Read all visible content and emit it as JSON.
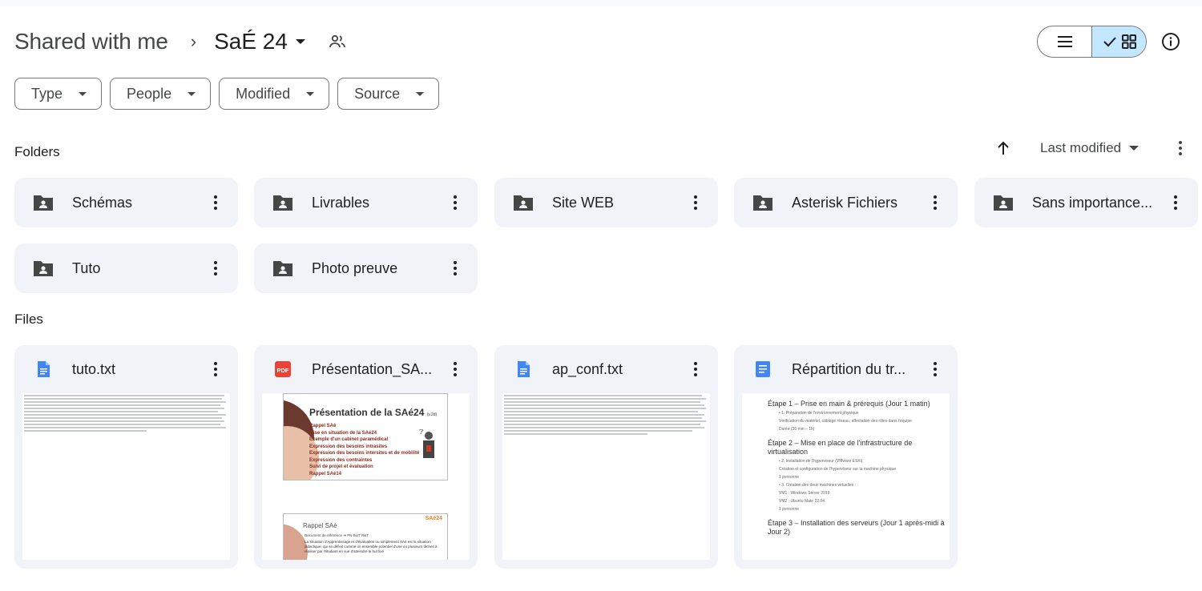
{
  "header": {
    "breadcrumb_root": "Shared with me",
    "breadcrumb_separator": "›",
    "current_folder": "SaÉ 24"
  },
  "view_toggle": {
    "list_icon": "list-view-icon",
    "grid_icon": "grid-view-icon",
    "active": "grid"
  },
  "filters": [
    {
      "label": "Type"
    },
    {
      "label": "People"
    },
    {
      "label": "Modified"
    },
    {
      "label": "Source"
    }
  ],
  "folders_section": {
    "title": "Folders",
    "sort_label": "Last modified",
    "items": [
      {
        "name": "Schémas"
      },
      {
        "name": "Livrables"
      },
      {
        "name": "Site WEB"
      },
      {
        "name": "Asterisk Fichiers"
      },
      {
        "name": "Sans importance..."
      },
      {
        "name": "Tuto"
      },
      {
        "name": "Photo preuve"
      }
    ]
  },
  "files_section": {
    "title": "Files",
    "items": [
      {
        "name": "tuto.txt",
        "type": "text",
        "icon": "google-docs-icon"
      },
      {
        "name": "Présentation_SA...",
        "type": "pdf",
        "icon": "pdf-icon"
      },
      {
        "name": "ap_conf.txt",
        "type": "text",
        "icon": "google-docs-icon"
      },
      {
        "name": "Répartition du tr...",
        "type": "doc",
        "icon": "google-docs-icon"
      }
    ]
  },
  "pdf_preview": {
    "title": "Présentation de la SAé24",
    "title_suffix": "(v.2d)",
    "bullets": [
      "Rappel SAé",
      "Mise en situation de la SAé24",
      "Exemple d'un cabinet paramédical",
      "Expression des besoins intrasites",
      "Expression des besoins intersites et de mobilité",
      "Expression des contraintes",
      "Suivi de projet et évaluation",
      "Rappel SAé14"
    ],
    "slide2_title": "Rappel SAé",
    "slide2_badge": "SAé24",
    "slide2_line1": "Document de référence ➔ PN BUT R&T",
    "slide2_line2": "La Situation d'Apprentissage et d'évaluation ou simplement SAé est la situation didactique, qui se définit comme un ensemble potentiel d'une ou plusieurs tâches à réaliser par l'étudiant en vue d'atteindre le but fixé"
  },
  "doc_preview": {
    "lines": [
      {
        "kind": "h",
        "text": "Étape 1 – Prise en main & prérequis (Jour 1 matin)"
      },
      {
        "kind": "s",
        "text": "• 1. Préparation de l'environnement physique"
      },
      {
        "kind": "s",
        "text": "Vérification du matériel, câblage réseau, affectation des rôles dans l'équipe"
      },
      {
        "kind": "s",
        "text": "Durée (30 min – 1h)"
      },
      {
        "kind": "h",
        "text": "Étape 2 – Mise en place de l'infrastructure de virtualisation"
      },
      {
        "kind": "s",
        "text": "• 2. Installation de l'hyperviseur (VMware ESXi)"
      },
      {
        "kind": "s",
        "text": "Création et configuration de l'hyperviseur sur la machine physique"
      },
      {
        "kind": "s",
        "text": "1 personne"
      },
      {
        "kind": "s",
        "text": "• 3. Création des deux machines virtuelles :"
      },
      {
        "kind": "s",
        "text": "VM1 : Windows Server 2019"
      },
      {
        "kind": "s",
        "text": "VM2 : Ubuntu Mate 22.04"
      },
      {
        "kind": "s",
        "text": "1 personne"
      },
      {
        "kind": "h",
        "text": "Étape 3 – Installation des serveurs (Jour 1 après-midi à Jour 2)"
      }
    ]
  },
  "colors": {
    "card_bg": "#f0f4f9",
    "active_toggle": "#c2e7ff",
    "doc_blue": "#4285f4",
    "pdf_red": "#ea4335"
  }
}
